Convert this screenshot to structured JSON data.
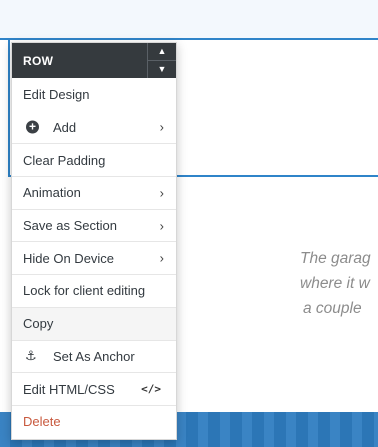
{
  "background": {
    "quote_lines": [
      "The garag",
      "where it w",
      "a couple"
    ]
  },
  "menu": {
    "title": "ROW",
    "arrow_up": "▲",
    "arrow_down": "▼",
    "chevron": "›",
    "code_icon": "</>",
    "anchor_icon": "⚓",
    "items": [
      {
        "label": "Edit Design"
      },
      {
        "label": "Add"
      },
      {
        "label": "Clear Padding"
      },
      {
        "label": "Animation"
      },
      {
        "label": "Save as Section"
      },
      {
        "label": "Hide On Device"
      },
      {
        "label": "Lock for client editing"
      },
      {
        "label": "Copy"
      },
      {
        "label": "Set As Anchor"
      },
      {
        "label": "Edit HTML/CSS"
      },
      {
        "label": "Delete"
      }
    ]
  },
  "colors": {
    "header_bg": "#353a3e",
    "selection_outline": "#2f84c9",
    "delete_text": "#c8593e",
    "footer_bar": "#2e7cc0"
  }
}
